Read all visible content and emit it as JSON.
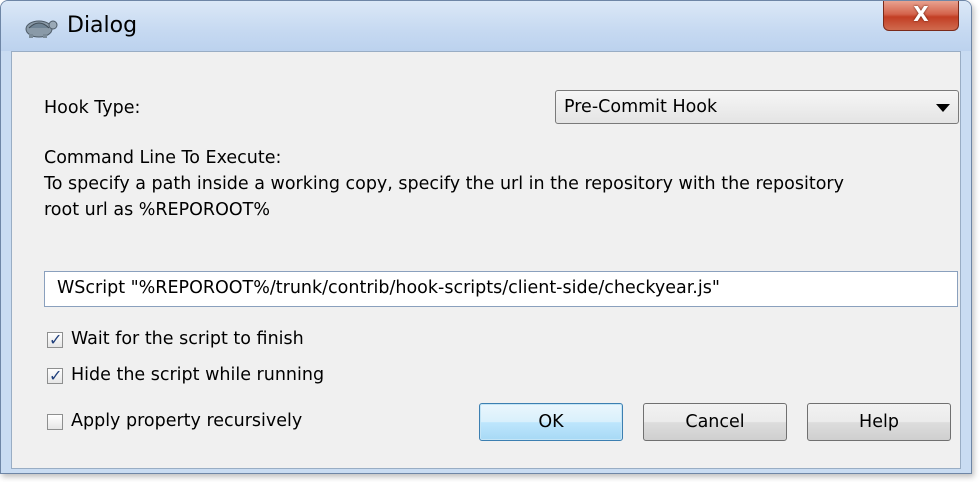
{
  "window": {
    "title": "Dialog",
    "close_label": "X"
  },
  "form": {
    "hook_type_label": "Hook Type:",
    "hook_type_value": "Pre-Commit Hook",
    "command_label": "Command Line To Execute:",
    "help_line_1": "To specify a path inside a working copy, specify the url in the repository with the repository",
    "help_line_2": "root url as %REPOROOT%",
    "command_value": "WScript \"%REPOROOT%/trunk/contrib/hook-scripts/client-side/checkyear.js\""
  },
  "options": [
    {
      "label": "Wait for the script to finish",
      "checked": true
    },
    {
      "label": "Hide the script while running",
      "checked": true
    },
    {
      "label": "Apply property recursively",
      "checked": false
    }
  ],
  "buttons": {
    "ok": "OK",
    "cancel": "Cancel",
    "help": "Help"
  },
  "icons": {
    "title": "tortoise-icon",
    "close": "close-icon",
    "dropdown": "chevron-down-icon",
    "check": "checkmark-icon"
  }
}
